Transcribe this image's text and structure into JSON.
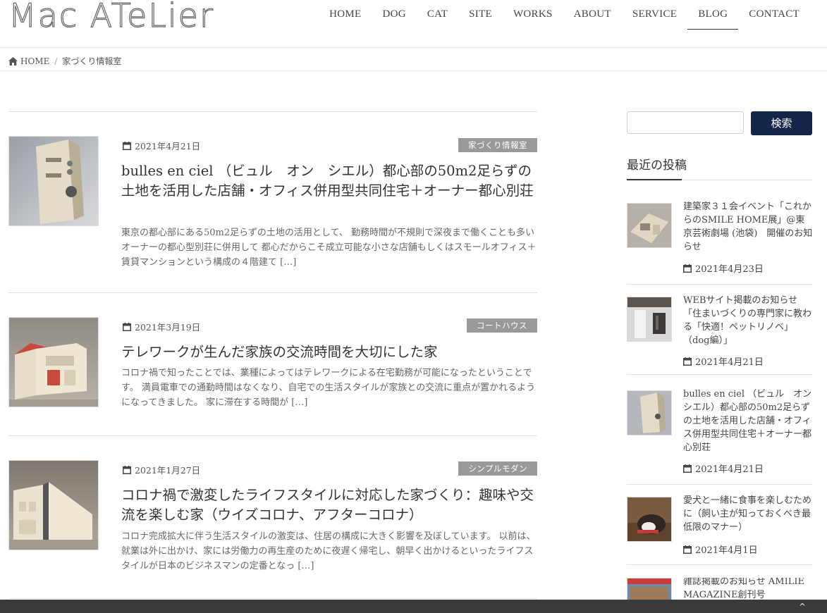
{
  "logo": {
    "text": "Mac ATeLier"
  },
  "nav": [
    "HOME",
    "DOG",
    "CAT",
    "SITE",
    "WORKS",
    "ABOUT",
    "SERVICE",
    "BLOG",
    "CONTACT"
  ],
  "breadcrumb": {
    "home": "HOME",
    "separator": "/",
    "current": "家づくり情報室"
  },
  "posts": [
    {
      "date": "2021年4月21日",
      "category": "家づくり情報室",
      "title": "bulles en ciel （ビュル　オン　シエル）都心部の50m2足らずの土地を活用した店舗・オフィス併用型共同住宅＋オーナー都心別荘",
      "excerpt": "東京の都心部にある50m2足らずの土地の活用として、 勤務時間が不規則で深夜まで働くことも多いオーナーの都心型別荘に併用して 都心だからこそ成立可能な小さな店舗もしくはスモールオフィス＋賃貸マンションという構成の４階建て […]"
    },
    {
      "date": "2021年3月19日",
      "category": "コートハウス",
      "title": "テレワークが生んだ家族の交流時間を大切にした家",
      "excerpt": "コロナ禍で知ったことでは、業種によってはテレワークによる在宅勤務が可能になったということです。 満員電車での通勤時間はなくなり、自宅での生活スタイルが家族との交流に重点が置かれるようになってきました。 家に滞在する時間が […]"
    },
    {
      "date": "2021年1月27日",
      "category": "シンプルモダン",
      "title": "コロナ禍で激変したライフスタイルに対応した家づくり：趣味や交流を楽しむ家（ウイズコロナ、アフターコロナ）",
      "excerpt": "コロナ完成拡大に伴う生活スタイルの激変は、住居の構成に大きく影響を及ぼしています。 以前は、就業は外に出かけ、家には労働力の再生産のために夜遅く帰宅し、朝早く出かけるといったライフスタイルが日本のビジネスマンの定番となっ […]"
    }
  ],
  "sidebar": {
    "search_button": "検索",
    "search_placeholder": "",
    "recent_title": "最近の投稿",
    "recent": [
      {
        "title": "建築家３１会イベント「これからのSMILE HOME展」@東京芸術劇場 (池袋)　開催のお知らせ",
        "date": "2021年4月23日"
      },
      {
        "title": "WEBサイト掲載のお知らせ「住まいづくりの専門家に教わる「快適！ペットリノベ」（dog編）」",
        "date": "2021年4月21日"
      },
      {
        "title": "bulles en ciel （ビュル　オン　シエル）都心部の50m2足らずの土地を活用した店舗・オフィス併用型共同住宅＋オーナー都心別荘",
        "date": "2021年4月21日"
      },
      {
        "title": "愛犬と一緒に食事を楽しむために（飼い主が知っておくべき最低限のマナー）",
        "date": "2021年4月1日"
      },
      {
        "title": "雑誌掲載のお知らせ AMILIE MAGAZINE創刊号",
        "date": ""
      }
    ]
  },
  "colors": {
    "accent": "#13264a",
    "badge": "#999999",
    "footer": "#3a3a3a"
  }
}
